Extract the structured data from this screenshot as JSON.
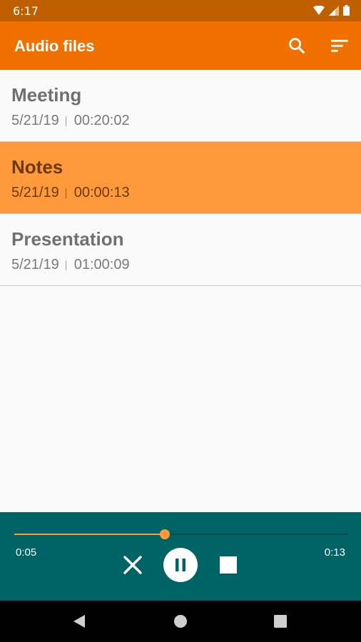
{
  "status_bar": {
    "time": "6:17",
    "icons": [
      "wifi-icon",
      "signal-icon",
      "battery-icon"
    ]
  },
  "app_bar": {
    "title": "Audio files",
    "actions": [
      "search-icon",
      "sort-icon"
    ]
  },
  "recordings": [
    {
      "title": "Meeting",
      "date": "5/21/19",
      "duration": "00:20:02",
      "selected": false
    },
    {
      "title": "Notes",
      "date": "5/21/19",
      "duration": "00:00:13",
      "selected": true
    },
    {
      "title": "Presentation",
      "date": "5/21/19",
      "duration": "01:00:09",
      "selected": false
    }
  ],
  "player": {
    "current_time": "0:05",
    "total_time": "0:13",
    "progress": 0.45,
    "controls": [
      "close-icon",
      "pause-icon",
      "stop-icon"
    ]
  },
  "nav_bar": {
    "buttons": [
      "back-icon",
      "home-icon",
      "recents-icon"
    ]
  },
  "colors": {
    "status_bar": "#c05f00",
    "app_bar": "#f07000",
    "selected_row": "#ff9a3c",
    "player_bg": "#006466",
    "accent": "#ff9a3c"
  }
}
